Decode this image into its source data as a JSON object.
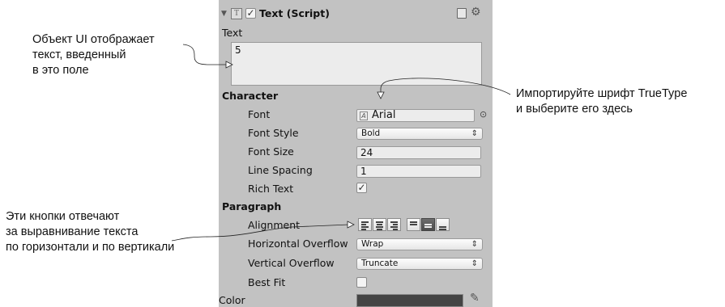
{
  "annotations": {
    "left_top": [
      "Объект UI отображает",
      "текст, введенный",
      "в это поле"
    ],
    "right": [
      "Импортируйте шрифт TrueType",
      "и выберите его здесь"
    ],
    "left_bottom": [
      "Эти кнопки отвечают",
      "за выравнивание текста",
      "по горизонтали и по вертикали"
    ]
  },
  "component": {
    "title": "Text (Script)",
    "enabled": true,
    "header_icon_glyph": "T",
    "book_icon": "help-book-icon",
    "gear_icon": "gear-icon"
  },
  "text": {
    "label": "Text",
    "value": "5"
  },
  "character": {
    "header": "Character",
    "font": {
      "label": "Font",
      "value": "Arial",
      "icon_glyph": "A"
    },
    "font_style": {
      "label": "Font Style",
      "value": "Bold"
    },
    "font_size": {
      "label": "Font Size",
      "value": "24"
    },
    "line_spacing": {
      "label": "Line Spacing",
      "value": "1"
    },
    "rich_text": {
      "label": "Rich Text",
      "checked": true
    }
  },
  "paragraph": {
    "header": "Paragraph",
    "alignment": {
      "label": "Alignment",
      "horizontal_active": "left",
      "vertical_active": "middle"
    },
    "horizontal_overflow": {
      "label": "Horizontal Overflow",
      "value": "Wrap"
    },
    "vertical_overflow": {
      "label": "Vertical Overflow",
      "value": "Truncate"
    },
    "best_fit": {
      "label": "Best Fit",
      "checked": false
    }
  },
  "color": {
    "label": "Color",
    "swatch": "#444444"
  },
  "colors": {
    "panel_bg": "#c2c2c2",
    "field_bg": "#ececec",
    "active_button": "#5a5a5a"
  },
  "glyphs": {
    "dropdown_arrow": "⇕",
    "checkmark": "✓",
    "fold": "▼",
    "target": "⊙"
  }
}
